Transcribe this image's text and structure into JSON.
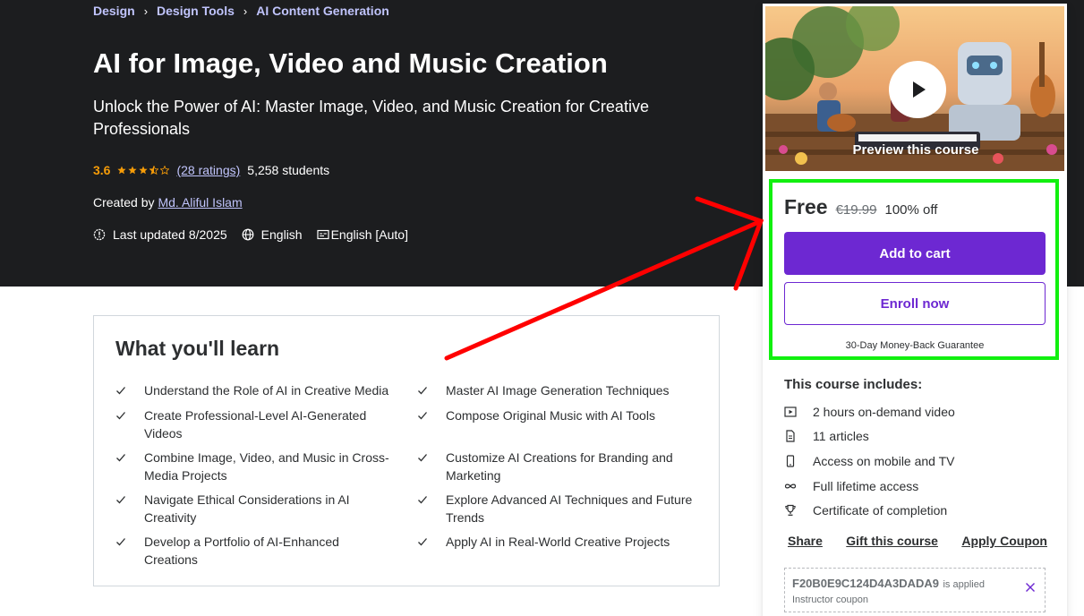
{
  "breadcrumb": [
    "Design",
    "Design Tools",
    "AI Content Generation"
  ],
  "course": {
    "title": "AI for Image, Video and Music Creation",
    "subtitle": "Unlock the Power of AI: Master Image, Video, and Music Creation for Creative Professionals",
    "rating": "3.6",
    "rating_stars": 3.5,
    "ratings_count": "(28 ratings)",
    "students": "5,258 students",
    "created_by_label": "Created by",
    "author": "Md. Aliful Islam",
    "last_updated": "Last updated 8/2025",
    "language": "English",
    "captions": "English [Auto]"
  },
  "learn": {
    "title": "What you'll learn",
    "items_left": [
      "Understand the Role of AI in Creative Media",
      "Create Professional-Level AI-Generated Videos",
      "Combine Image, Video, and Music in Cross-Media Projects",
      "Navigate Ethical Considerations in AI Creativity",
      "Develop a Portfolio of AI-Enhanced Creations"
    ],
    "items_right": [
      "Master AI Image Generation Techniques",
      "Compose Original Music with AI Tools",
      "Customize AI Creations for Branding and Marketing",
      "Explore Advanced AI Techniques and Future Trends",
      "Apply AI in Real-World Creative Projects"
    ]
  },
  "sidebar": {
    "preview_label": "Preview this course",
    "price": "Free",
    "original_price": "€19.99",
    "discount": "100% off",
    "add_to_cart": "Add to cart",
    "enroll_now": "Enroll now",
    "guarantee": "30-Day Money-Back Guarantee",
    "includes_title": "This course includes:",
    "includes": [
      "2 hours on-demand video",
      "11 articles",
      "Access on mobile and TV",
      "Full lifetime access",
      "Certificate of completion"
    ],
    "links": [
      "Share",
      "Gift this course",
      "Apply Coupon"
    ],
    "coupon_code": "F20B0E9C124D4A3DADA9",
    "coupon_applied": "is applied",
    "coupon_type": "Instructor coupon"
  },
  "colors": {
    "hero_bg": "#1c1d1f",
    "accent_purple": "#6d28d2",
    "link_lavender": "#c0c4fc",
    "star_orange": "#f69c08",
    "highlight_green": "#11f00f",
    "arrow_red": "#ff0000"
  }
}
